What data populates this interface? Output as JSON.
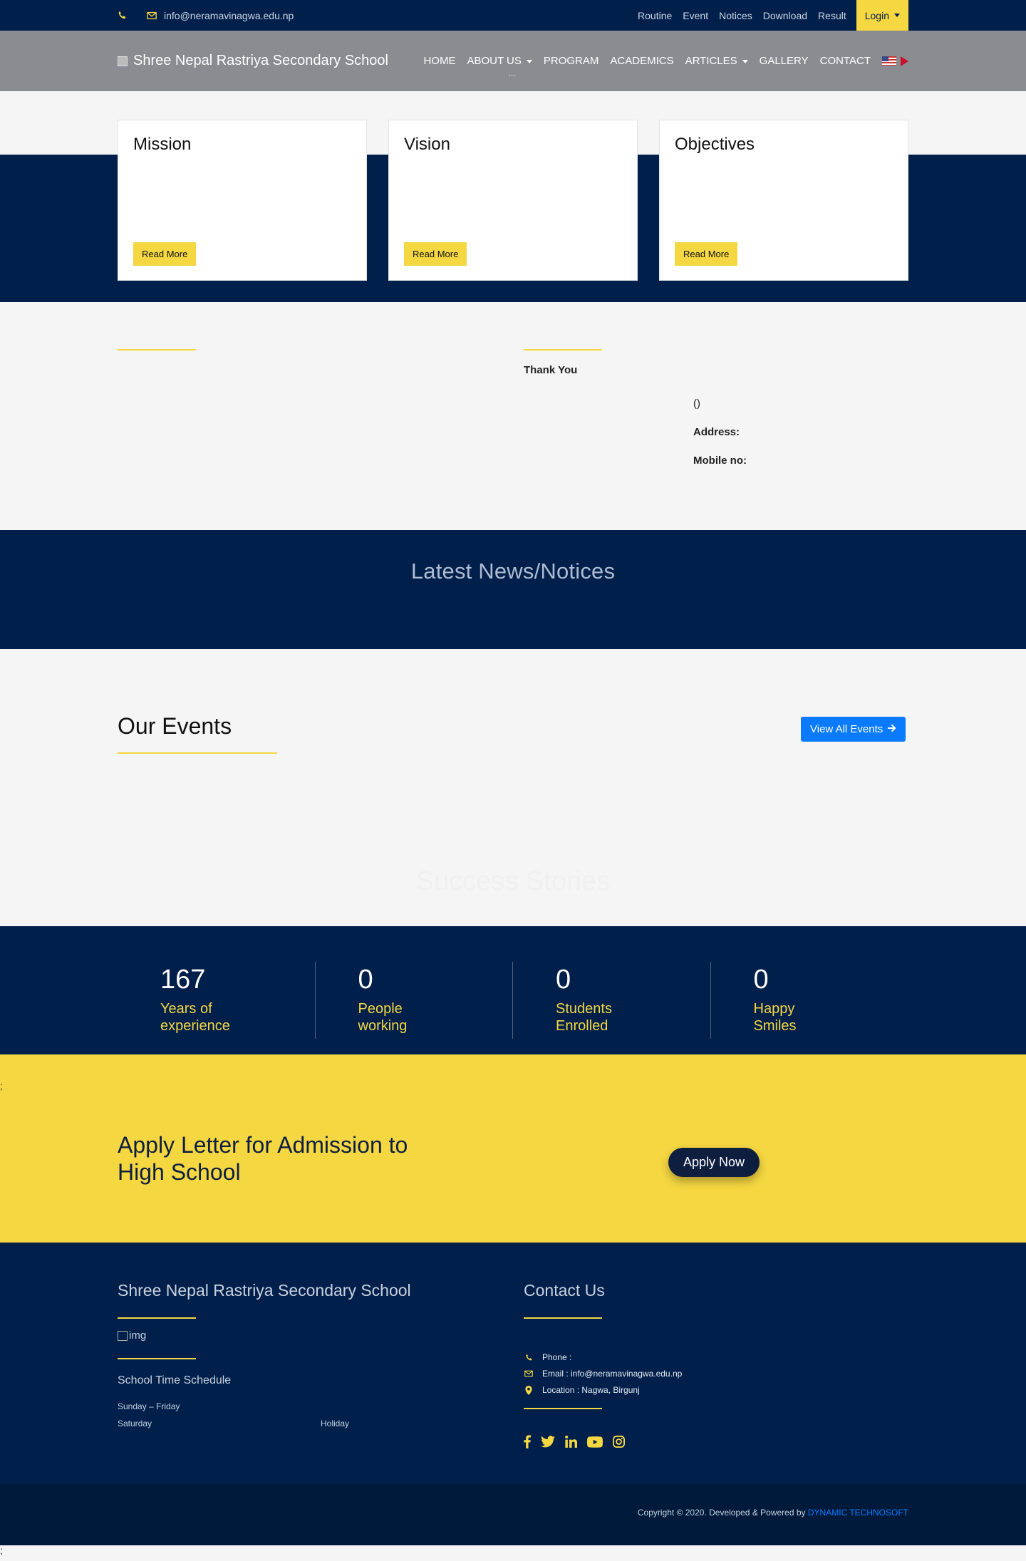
{
  "topbar": {
    "email": "info@neramavinagwa.edu.np",
    "links": [
      "Routine",
      "Event",
      "Notices",
      "Download",
      "Result"
    ],
    "login": "Login"
  },
  "nav": {
    "brand": "Shree Nepal Rastriya Secondary School",
    "items": [
      "HOME",
      "ABOUT US",
      "PROGRAM",
      "ACADEMICS",
      "ARTICLES",
      "GALLERY",
      "CONTACT"
    ],
    "dots": "..."
  },
  "cards": [
    {
      "title": "Mission",
      "button": "Read More"
    },
    {
      "title": "Vision",
      "button": "Read More"
    },
    {
      "title": "Objectives",
      "button": "Read More"
    }
  ],
  "message": {
    "thank_you": "Thank You",
    "paren": "()",
    "address": "Address:",
    "mobile": "Mobile no:"
  },
  "news": {
    "title": "Latest News/Notices"
  },
  "events": {
    "title": "Our Events",
    "view_all": "View All Events",
    "success": "Success Stories"
  },
  "stats": [
    {
      "value": "167",
      "label1": "Years of",
      "label2": "experience"
    },
    {
      "value": "0",
      "label1": "People",
      "label2": "working"
    },
    {
      "value": "0",
      "label1": "Students",
      "label2": "Enrolled"
    },
    {
      "value": "0",
      "label1": "Happy",
      "label2": "Smiles"
    }
  ],
  "apply": {
    "semicolon": ";",
    "title": "Apply Letter for Admission to High School",
    "button": "Apply Now"
  },
  "footer": {
    "school_name": "Shree Nepal Rastriya Secondary School",
    "img_alt": "img",
    "schedule_title": "School Time Schedule",
    "days1": "Sunday – Friday",
    "days2": "Saturday",
    "holiday": "Holiday",
    "contact_title": "Contact Us",
    "phone": "Phone :",
    "email": "Email : info@neramavinagwa.edu.np",
    "location": "Location : Nagwa, Birgunj"
  },
  "copyright": {
    "text": "Copyright © 2020. Developed & Powered by",
    "company": "DYNAMIC TECHNOSOFT"
  },
  "bottom_semicolon": ";",
  "colors": {
    "navy": "#001f4b",
    "yellow": "#f5d742",
    "blue": "#0a7bff",
    "gray_nav": "#8a8c91"
  }
}
